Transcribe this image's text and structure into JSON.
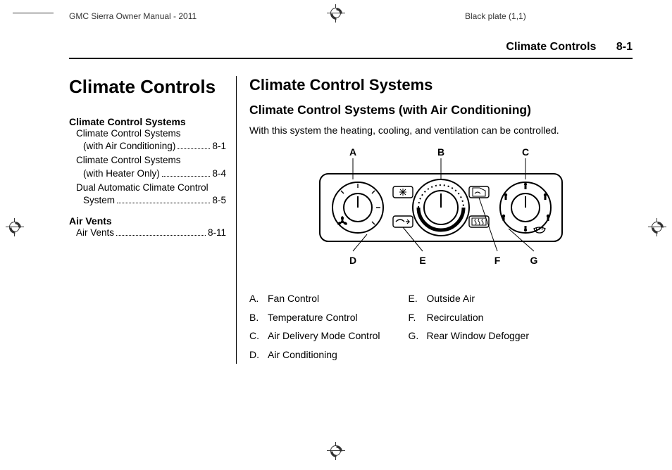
{
  "meta": {
    "doc_title": "GMC Sierra Owner Manual - 2011",
    "plate": "Black plate (1,1)"
  },
  "running_head": {
    "section": "Climate Controls",
    "page": "8-1"
  },
  "chapter_title": "Climate Controls",
  "toc": {
    "group1_title": "Climate Control Systems",
    "items1": [
      {
        "label_line1": "Climate Control Systems",
        "label_line2": "(with Air Conditioning)",
        "page": "8-1"
      },
      {
        "label_line1": "Climate Control Systems",
        "label_line2": "(with Heater Only)",
        "page": "8-4"
      },
      {
        "label_line1": "Dual Automatic Climate Control",
        "label_line2": "System",
        "page": "8-5"
      }
    ],
    "group2_title": "Air Vents",
    "items2": [
      {
        "label": "Air Vents",
        "page": "8-11"
      }
    ]
  },
  "main": {
    "h2": "Climate Control Systems",
    "h3": "Climate Control Systems (with Air Conditioning)",
    "intro": "With this system the heating, cooling, and ventilation can be controlled."
  },
  "diagram": {
    "callouts_top": [
      "A",
      "B",
      "C"
    ],
    "callouts_bottom": [
      "D",
      "E",
      "F",
      "G"
    ]
  },
  "legend": {
    "col1": [
      {
        "letter": "A.",
        "text": "Fan Control"
      },
      {
        "letter": "B.",
        "text": "Temperature Control"
      },
      {
        "letter": "C.",
        "text": "Air Delivery Mode Control"
      },
      {
        "letter": "D.",
        "text": "Air Conditioning"
      }
    ],
    "col2": [
      {
        "letter": "E.",
        "text": "Outside Air"
      },
      {
        "letter": "F.",
        "text": "Recirculation"
      },
      {
        "letter": "G.",
        "text": "Rear Window Defogger"
      }
    ]
  }
}
